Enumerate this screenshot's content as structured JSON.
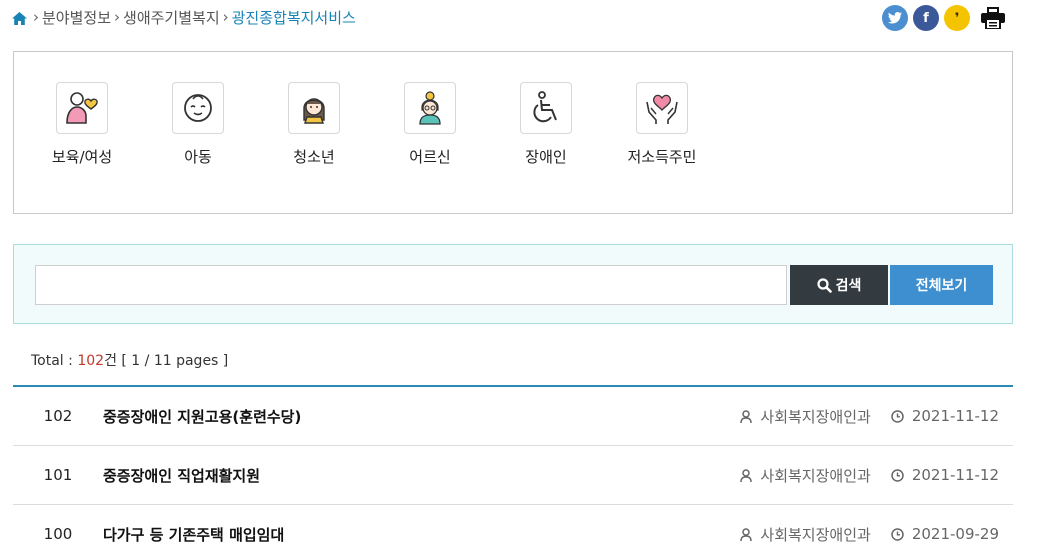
{
  "breadcrumb": {
    "items": [
      "분야별정보",
      "생애주기별복지",
      "광진종합복지서비스"
    ]
  },
  "share": {
    "twitter": "t",
    "facebook": "f",
    "kakaostory": "❜"
  },
  "categories": [
    {
      "label": "보육/여성",
      "icon": "mother-baby-icon"
    },
    {
      "label": "아동",
      "icon": "child-face-icon"
    },
    {
      "label": "청소년",
      "icon": "teen-icon"
    },
    {
      "label": "어르신",
      "icon": "elderly-icon"
    },
    {
      "label": "장애인",
      "icon": "wheelchair-icon"
    },
    {
      "label": "저소득주민",
      "icon": "heart-hands-icon"
    }
  ],
  "search": {
    "placeholder": "",
    "search_label": "검색",
    "all_label": "전체보기"
  },
  "total": {
    "prefix": "Total : ",
    "count": "102",
    "suffix": "건 [ 1 / 11 pages ]"
  },
  "rows": [
    {
      "no": "102",
      "title": "중증장애인 지원고용(훈련수당)",
      "dept": "사회복지장애인과",
      "date": "2021-11-12"
    },
    {
      "no": "101",
      "title": "중증장애인 직업재활지원",
      "dept": "사회복지장애인과",
      "date": "2021-11-12"
    },
    {
      "no": "100",
      "title": "다가구 등 기존주택 매입임대",
      "dept": "사회복지장애인과",
      "date": "2021-09-29"
    }
  ],
  "colors": {
    "accent": "#1a83b6",
    "search_button": "#333a40",
    "all_button": "#3d8fd0",
    "count": "#c0392b"
  }
}
